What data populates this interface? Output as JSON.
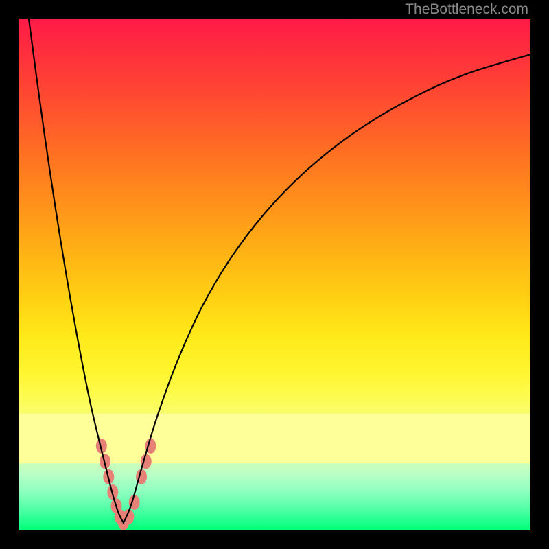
{
  "watermark": "TheBottleneck.com",
  "chart_data": {
    "type": "line",
    "title": "",
    "xlabel": "",
    "ylabel": "",
    "axis_ranges": {
      "x": [
        0,
        100
      ],
      "y": [
        0,
        100
      ]
    },
    "grid": false,
    "legend": false,
    "background_gradient": {
      "stops": [
        {
          "pos": 0.0,
          "color": "#ff1a47"
        },
        {
          "pos": 0.5,
          "color": "#ffcf13"
        },
        {
          "pos": 0.77,
          "color": "#ffff9a"
        },
        {
          "pos": 1.0,
          "color": "#00ff78"
        }
      ],
      "pale_band_y": [
        13,
        23
      ]
    },
    "series": [
      {
        "name": "left-branch",
        "x": [
          2.0,
          4.0,
          6.0,
          8.0,
          10.0,
          12.0,
          14.0,
          16.0,
          18.0,
          19.0,
          19.7,
          20.5
        ],
        "y": [
          100.0,
          85.0,
          71.0,
          58.0,
          46.0,
          35.0,
          25.0,
          16.5,
          8.5,
          5.0,
          3.0,
          1.5
        ]
      },
      {
        "name": "right-branch",
        "x": [
          20.5,
          22.0,
          24.0,
          27.0,
          31.0,
          36.0,
          42.0,
          49.0,
          57.0,
          66.0,
          76.0,
          87.0,
          100.0
        ],
        "y": [
          1.5,
          5.0,
          12.0,
          22.0,
          33.0,
          44.0,
          54.0,
          63.0,
          71.0,
          78.0,
          84.0,
          89.0,
          93.0
        ]
      }
    ],
    "markers": {
      "shape": "ellipse",
      "color": "#e78178",
      "points": [
        {
          "x": 16.2,
          "y": 16.5
        },
        {
          "x": 16.9,
          "y": 13.5
        },
        {
          "x": 17.6,
          "y": 10.5
        },
        {
          "x": 18.4,
          "y": 7.5
        },
        {
          "x": 19.1,
          "y": 4.8
        },
        {
          "x": 19.8,
          "y": 2.7
        },
        {
          "x": 20.5,
          "y": 1.5
        },
        {
          "x": 21.5,
          "y": 2.7
        },
        {
          "x": 22.6,
          "y": 5.5
        },
        {
          "x": 24.0,
          "y": 10.5
        },
        {
          "x": 24.9,
          "y": 13.5
        },
        {
          "x": 25.8,
          "y": 16.5
        }
      ]
    }
  }
}
